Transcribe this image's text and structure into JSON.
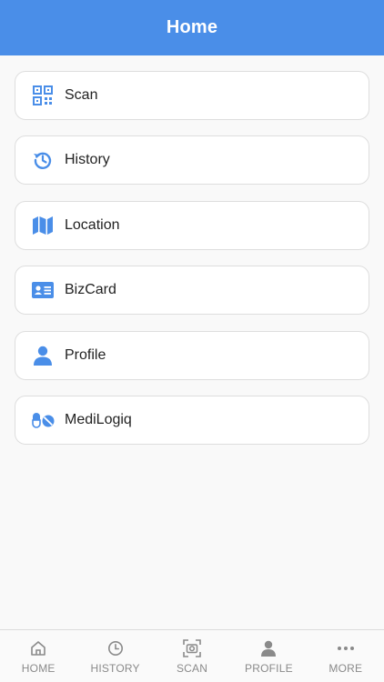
{
  "header": {
    "title": "Home"
  },
  "colors": {
    "accent": "#4a8ee8",
    "tab_inactive": "#8a8a8a"
  },
  "menu": {
    "items": [
      {
        "label": "Scan",
        "icon": "qr-code-icon"
      },
      {
        "label": "History",
        "icon": "history-icon"
      },
      {
        "label": "Location",
        "icon": "map-icon"
      },
      {
        "label": "BizCard",
        "icon": "id-card-icon"
      },
      {
        "label": "Profile",
        "icon": "user-icon"
      },
      {
        "label": "MediLogiq",
        "icon": "pills-icon"
      }
    ]
  },
  "tabbar": {
    "items": [
      {
        "label": "HOME",
        "icon": "home-icon"
      },
      {
        "label": "HISTORY",
        "icon": "clock-icon"
      },
      {
        "label": "SCAN",
        "icon": "scan-camera-icon"
      },
      {
        "label": "PROFILE",
        "icon": "person-icon"
      },
      {
        "label": "MORE",
        "icon": "ellipsis-icon"
      }
    ]
  }
}
